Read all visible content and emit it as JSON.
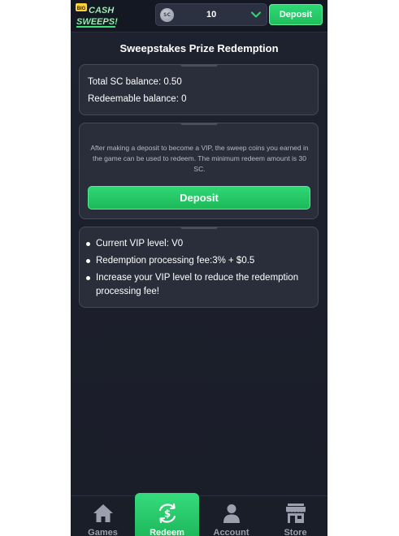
{
  "header": {
    "logo": {
      "line1": "BIG",
      "line2": "CASH",
      "line3": "SWEEPS!"
    },
    "coin_badge": "SC",
    "balance_value": "10",
    "deposit_label": "Deposit"
  },
  "page": {
    "title": "Sweepstakes Prize Redemption"
  },
  "balance_card": {
    "total_sc": "Total SC balance: 0.50",
    "redeemable": "Redeemable balance: 0"
  },
  "info_card": {
    "description": "After making a deposit to become a VIP, the sweep coins you earned in the game can be used to redeem. The minimum redeem amount is 30 SC.",
    "deposit_label": "Deposit"
  },
  "vip_card": {
    "items": [
      "Current VIP level: V0",
      "Redemption processing fee:3% + $0.5",
      "Increase your VIP level to reduce the redemption processing fee!"
    ]
  },
  "nav": {
    "items": [
      {
        "label": "Games",
        "icon": "home-icon"
      },
      {
        "label": "Redeem",
        "icon": "redeem-dollar-icon"
      },
      {
        "label": "Account",
        "icon": "user-icon"
      },
      {
        "label": "Store",
        "icon": "store-icon"
      }
    ],
    "active": "Redeem"
  },
  "colors": {
    "accent_green": "#22c55e",
    "background": "#1c202c",
    "card": "#2a2e3b"
  }
}
